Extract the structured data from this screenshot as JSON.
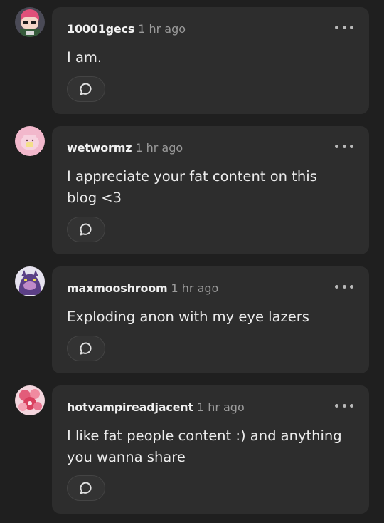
{
  "comments": [
    {
      "username": "10001gecs",
      "time": "1 hr ago",
      "text": "I am.",
      "avatar_icon": "pink-hair-character-avatar-icon"
    },
    {
      "username": "wetwormz",
      "time": "1 hr ago",
      "text": "I appreciate your fat content on this blog <3",
      "avatar_icon": "pink-blob-avatar-icon"
    },
    {
      "username": "maxmooshroom",
      "time": "1 hr ago",
      "text": "Exploding anon with my eye lazers",
      "avatar_icon": "purple-creature-avatar-icon"
    },
    {
      "username": "hotvampireadjacent",
      "time": "1 hr ago",
      "text": "I like fat people content :) and anything you wanna share",
      "avatar_icon": "pink-floral-avatar-icon"
    }
  ],
  "actions": {
    "more_icon": "more-dots-icon",
    "reply_icon": "reply-bubble-icon"
  },
  "colors": {
    "background": "#1f1f1f",
    "card": "#2d2d2d",
    "username": "#f0f0f0",
    "timestamp": "#9b9b9b"
  }
}
